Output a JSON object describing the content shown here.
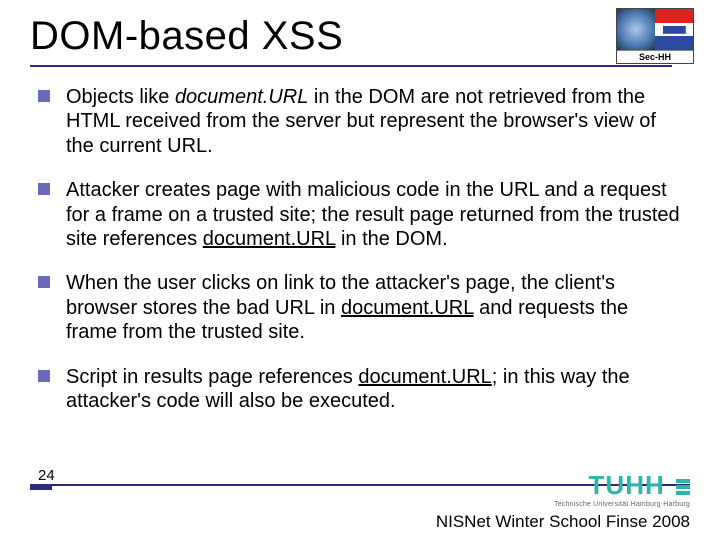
{
  "title": "DOM-based XSS",
  "badge_label": "Sec-HH",
  "bullets": [
    {
      "pre": "Objects like ",
      "em": "document.URL",
      "post": " in the DOM are not retrieved from the HTML received from the server but represent the browser's view of the current URL."
    },
    {
      "pre": "Attacker creates page with malicious code in the URL and a request for a frame on a trusted site; the result page returned from the trusted site references ",
      "em": "document.URL",
      "post": " in the DOM."
    },
    {
      "pre": "When the user clicks on link to the attacker's page, the client's browser stores the bad URL in ",
      "em": "document.URL",
      "post": " and requests the frame from the trusted site."
    },
    {
      "pre": "Script in results page references ",
      "em": "document.URL",
      "post": "; in this way the attacker's code will also be executed."
    }
  ],
  "page_number": "24",
  "org_logo_text": "TUHH",
  "org_subtext": "Technische Universität Hamburg-Harburg",
  "footer": "NISNet Winter School Finse 2008"
}
